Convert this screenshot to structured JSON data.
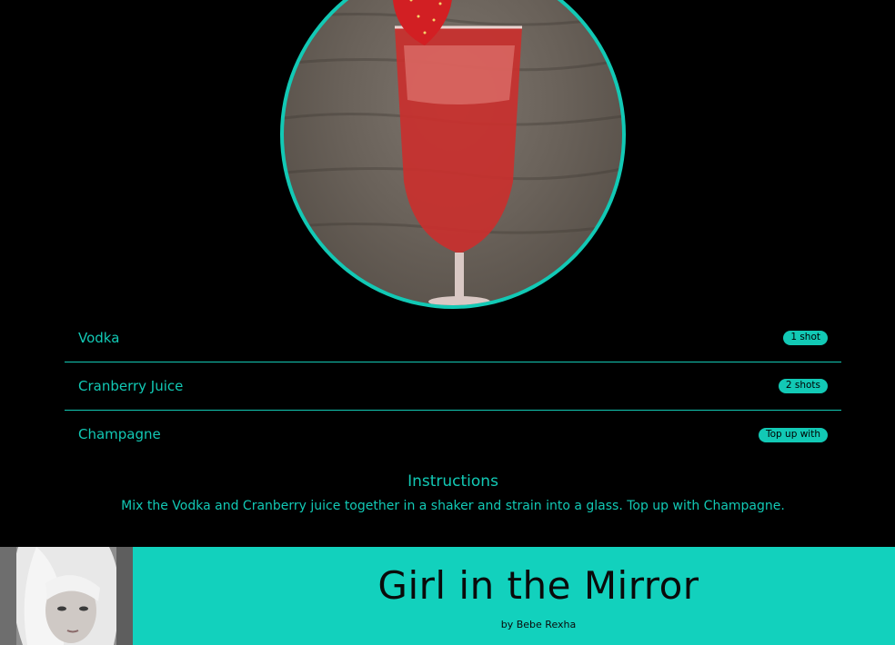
{
  "theme": {
    "accent": "#12c9b5",
    "background": "#000000",
    "song_bar": "#12d1bd"
  },
  "cocktail": {
    "image_icon": "cocktail-photo-icon",
    "ingredients": [
      {
        "name": "Vodka",
        "amount": "1 shot"
      },
      {
        "name": "Cranberry Juice",
        "amount": "2 shots"
      },
      {
        "name": "Champagne",
        "amount": "Top up with"
      }
    ],
    "instructions_title": "Instructions",
    "instructions_text": "Mix the Vodka and Cranberry juice together in a shaker and strain into a glass. Top up with Champagne."
  },
  "song": {
    "art_icon": "album-art-icon",
    "title": "Girl in the Mirror",
    "artist": "by Bebe Rexha"
  }
}
